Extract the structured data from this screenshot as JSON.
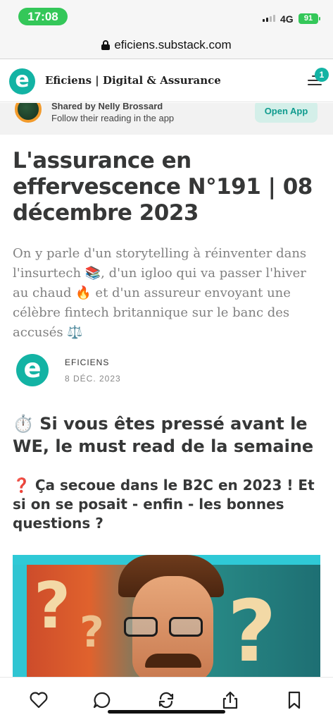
{
  "status_bar": {
    "time": "17:08",
    "network": "4G",
    "battery": "91"
  },
  "browser": {
    "url": "eficiens.substack.com"
  },
  "header": {
    "publication_name": "Eficiens | Digital & Assurance",
    "logo_letter": "e",
    "notification_count": "1"
  },
  "shared_banner": {
    "title": "Shared by Nelly Brossard",
    "subtitle": "Follow their reading in the app",
    "button_label": "Open App"
  },
  "article": {
    "title": "L'assurance en effervescence N°191 | 08 décembre 2023",
    "subtitle": "On y parle d'un storytelling à réinventer dans l'insurtech 📚, d'un igloo qui va passer l'hiver au chaud 🔥 et d'un assureur envoyant une célèbre fintech britannique sur le banc des accusés ⚖️",
    "author": "EFICIENS",
    "date": "8 DÉC. 2023",
    "section_heading": "⏱️ Si vous êtes pressé avant le WE, le must read de la semaine",
    "subheading_icon": "❓",
    "subheading": "Ça secoue dans le B2C en 2023 ! Et si on se posait - enfin - les bonnes questions ?"
  },
  "toolbar": {
    "items": [
      "like-icon",
      "comment-icon",
      "restack-icon",
      "share-icon",
      "bookmark-icon"
    ]
  }
}
